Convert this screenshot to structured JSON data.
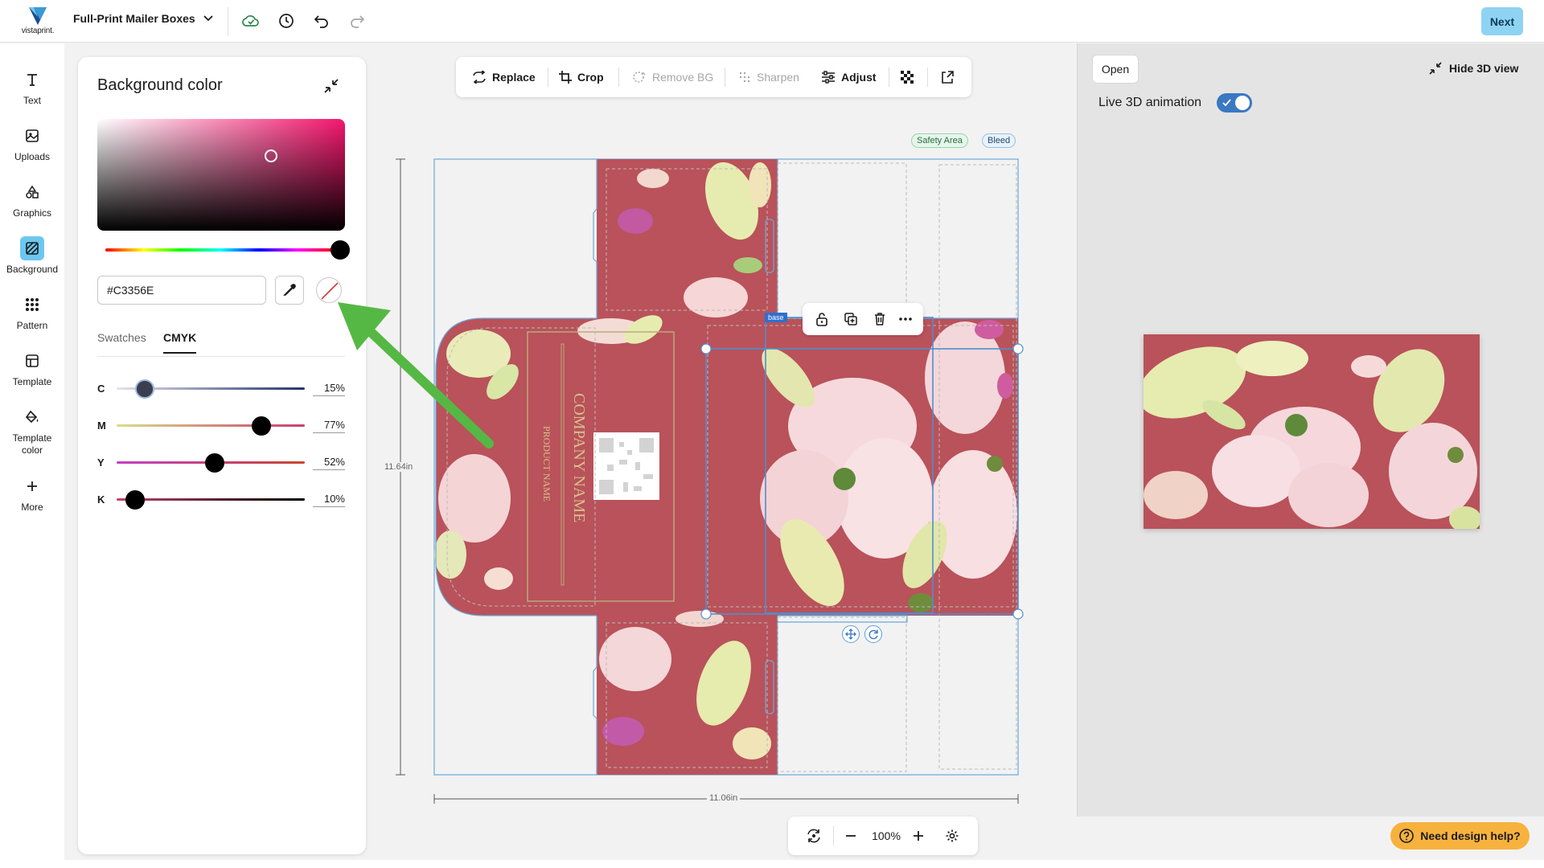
{
  "header": {
    "brand_word": "vistaprint.",
    "product_title": "Full-Print Mailer Boxes",
    "next_label": "Next"
  },
  "rail": {
    "items": [
      {
        "label": "Text",
        "icon": "text-icon"
      },
      {
        "label": "Uploads",
        "icon": "upload-icon"
      },
      {
        "label": "Graphics",
        "icon": "shapes-icon"
      },
      {
        "label": "Background",
        "icon": "background-icon"
      },
      {
        "label": "Pattern",
        "icon": "pattern-icon"
      },
      {
        "label": "Template",
        "icon": "template-icon"
      },
      {
        "label": "Template color",
        "icon": "paint-bucket-icon"
      },
      {
        "label": "More",
        "icon": "plus-icon"
      }
    ],
    "active": "Background"
  },
  "color_panel": {
    "title": "Background color",
    "hex_value": "#C3356E",
    "tabs": [
      {
        "label": "Swatches"
      },
      {
        "label": "CMYK"
      }
    ],
    "active_tab": "CMYK",
    "cmyk": [
      {
        "letter": "C",
        "value": "15%",
        "level": 0.15
      },
      {
        "letter": "M",
        "value": "77%",
        "level": 0.77
      },
      {
        "letter": "Y",
        "value": "52%",
        "level": 0.52
      },
      {
        "letter": "K",
        "value": "10%",
        "level": 0.1
      }
    ]
  },
  "image_toolbar": {
    "replace": "Replace",
    "crop": "Crop",
    "remove_bg": "Remove BG",
    "sharpen": "Sharpen",
    "adjust": "Adjust"
  },
  "canvas": {
    "safety_area": "Safety Area",
    "bleed": "Bleed",
    "height_label": "11.64in",
    "width_label": "11.06in",
    "base_tag": "base",
    "company_name": "COMPANY NAME",
    "product_name": "PRODUCT NAME",
    "background_color": "#B9525A"
  },
  "zoom": {
    "value": "100%"
  },
  "preview": {
    "open_label": "Open",
    "hide_label": "Hide 3D view",
    "live_label": "Live 3D animation",
    "live_on": true
  },
  "help": {
    "label": "Need design help?"
  },
  "colors": {
    "accent": "#8fd3f2",
    "toggle": "#3a78c2",
    "arrow": "#56b844",
    "help": "#f7b23e"
  }
}
